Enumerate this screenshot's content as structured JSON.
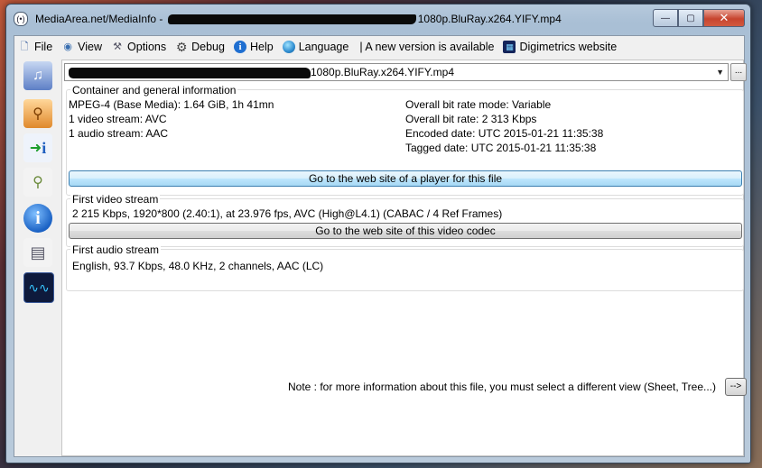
{
  "window": {
    "title_prefix": "MediaArea.net/MediaInfo - ",
    "title_suffix": "1080p.BluRay.x264.YIFY.mp4",
    "minimize": "—",
    "maximize": "▢",
    "close": "✕"
  },
  "menu": {
    "items": [
      {
        "label": "File",
        "icon": "file-icon"
      },
      {
        "label": "View",
        "icon": "view-icon"
      },
      {
        "label": "Options",
        "icon": "options-icon"
      },
      {
        "label": "Debug",
        "icon": "gear-icon"
      },
      {
        "label": "Help",
        "icon": "info-icon"
      },
      {
        "label": "Language",
        "icon": "globe-icon"
      }
    ],
    "new_version": "| A new version is available",
    "website": "Digimetrics website"
  },
  "toolbar": {
    "icons": [
      "basic-view-icon",
      "sheet-view-icon",
      "export-icon",
      "tree-view-icon",
      "about-icon",
      "report-icon",
      "waveform-icon"
    ]
  },
  "file": {
    "selected_suffix": "1080p.BluRay.x264.YIFY.mp4",
    "browse_label": "..."
  },
  "general": {
    "title": "Container and general information",
    "left": [
      "MPEG-4 (Base Media): 1.64 GiB, 1h 41mn",
      "1 video stream: AVC",
      "1 audio stream: AAC"
    ],
    "right": [
      "Overall bit rate mode: Variable",
      "Overall bit rate: 2 313 Kbps",
      "Encoded date: UTC 2015-01-21 11:35:38",
      "Tagged date: UTC 2015-01-21 11:35:38"
    ],
    "player_button": "Go to the web site of a player for this file"
  },
  "video": {
    "title": "First video stream",
    "info": "2 215 Kbps, 1920*800 (2.40:1), at 23.976 fps, AVC (High@L4.1) (CABAC / 4 Ref Frames)",
    "codec_button": "Go to the web site of this video codec"
  },
  "audio": {
    "title": "First audio stream",
    "info": "English, 93.7 Kbps, 48.0 KHz, 2 channels, AAC (LC)"
  },
  "note": {
    "text": "Note : for more information about this file, you must select a different view (Sheet, Tree...)",
    "button": "-->"
  }
}
